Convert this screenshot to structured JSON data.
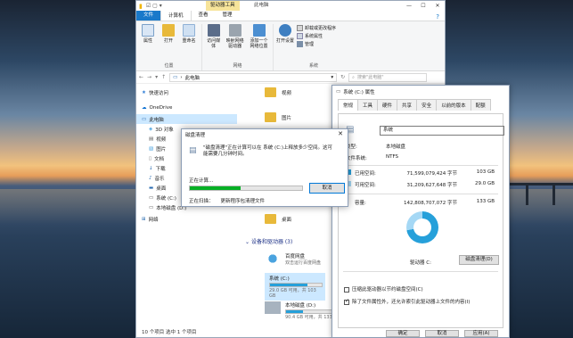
{
  "explorer": {
    "ribbon_context": "驱动器工具",
    "title": "此电脑",
    "tabs": [
      "文件",
      "计算机",
      "查看",
      "管理"
    ],
    "groups": {
      "location": {
        "label": "位置",
        "buttons": [
          "属性",
          "打开",
          "重命名"
        ]
      },
      "network": {
        "label": "网络",
        "buttons": [
          "访问媒体",
          "映射网络驱动器",
          "添加一个网络位置"
        ]
      },
      "system": {
        "label": "系统",
        "buttons": [
          "打开设置"
        ],
        "small": [
          "卸载或更改程序",
          "系统属性",
          "管理"
        ]
      }
    },
    "address": {
      "path": "此电脑",
      "search_placeholder": "搜索\"此电脑\""
    },
    "nav": [
      "快速访问",
      "OneDrive",
      "此电脑",
      "3D 对象",
      "视频",
      "图片",
      "文档",
      "下载",
      "音乐",
      "桌面",
      "系统 (C:)",
      "本地磁盘 (D:)",
      "网络"
    ],
    "folders": [
      "视频",
      "图片",
      "桌面"
    ],
    "section_title": "设备和驱动器 (3)",
    "drives": [
      {
        "name": "百度网盘",
        "sub": "双击运行百度网盘",
        "fill": 0
      },
      {
        "name": "系统 (C:)",
        "sub": "29.0 GB 可用，共 103 GB",
        "fill": 0.72
      },
      {
        "name": "本地磁盘 (D:)",
        "sub": "90.4 GB 可用，共 133 GB",
        "fill": 0.32
      }
    ],
    "status": "10 个项目  选中 1 个项目"
  },
  "properties": {
    "title": "系统 (C:) 属性",
    "tabs": [
      "常规",
      "工具",
      "硬件",
      "共享",
      "安全",
      "以前的版本",
      "配额"
    ],
    "name": "系统",
    "type_label": "类型:",
    "type_value": "本地磁盘",
    "fs_label": "文件系统:",
    "fs_value": "NTFS",
    "used_label": "已用空间:",
    "used_bytes": "71,599,079,424 字节",
    "used_gb": "103 GB",
    "free_label": "可用空间:",
    "free_bytes": "31,209,627,648 字节",
    "free_gb": "29.0 GB",
    "cap_label": "容量:",
    "cap_bytes": "142,808,707,072 字节",
    "cap_gb": "133 GB",
    "drive_label": "驱动器 C:",
    "cleanup_button": "磁盘清理(D)",
    "used_fraction": 0.72,
    "compress_label": "压缩此驱动器以节约磁盘空间(C)",
    "index_label": "除了文件属性外，还允许索引此驱动器上文件的内容(I)",
    "ok": "确定",
    "cancel": "取消",
    "apply": "应用(A)"
  },
  "cleanup": {
    "title": "磁盘清理",
    "message": "\"磁盘清理\"正在计算可以在 系统 (C:)上释放多少空间。这可能需要几分钟时间。",
    "calculating": "正在计算...",
    "cancel": "取消",
    "scan_label": "正在扫描：",
    "scan_item": "更新程序包清理文件",
    "progress": 0.45
  },
  "colors": {
    "accent": "#1979ca",
    "progress": "#06b025",
    "drive_bar": "#26a0da",
    "ribbon_context": "#f7e49a"
  }
}
